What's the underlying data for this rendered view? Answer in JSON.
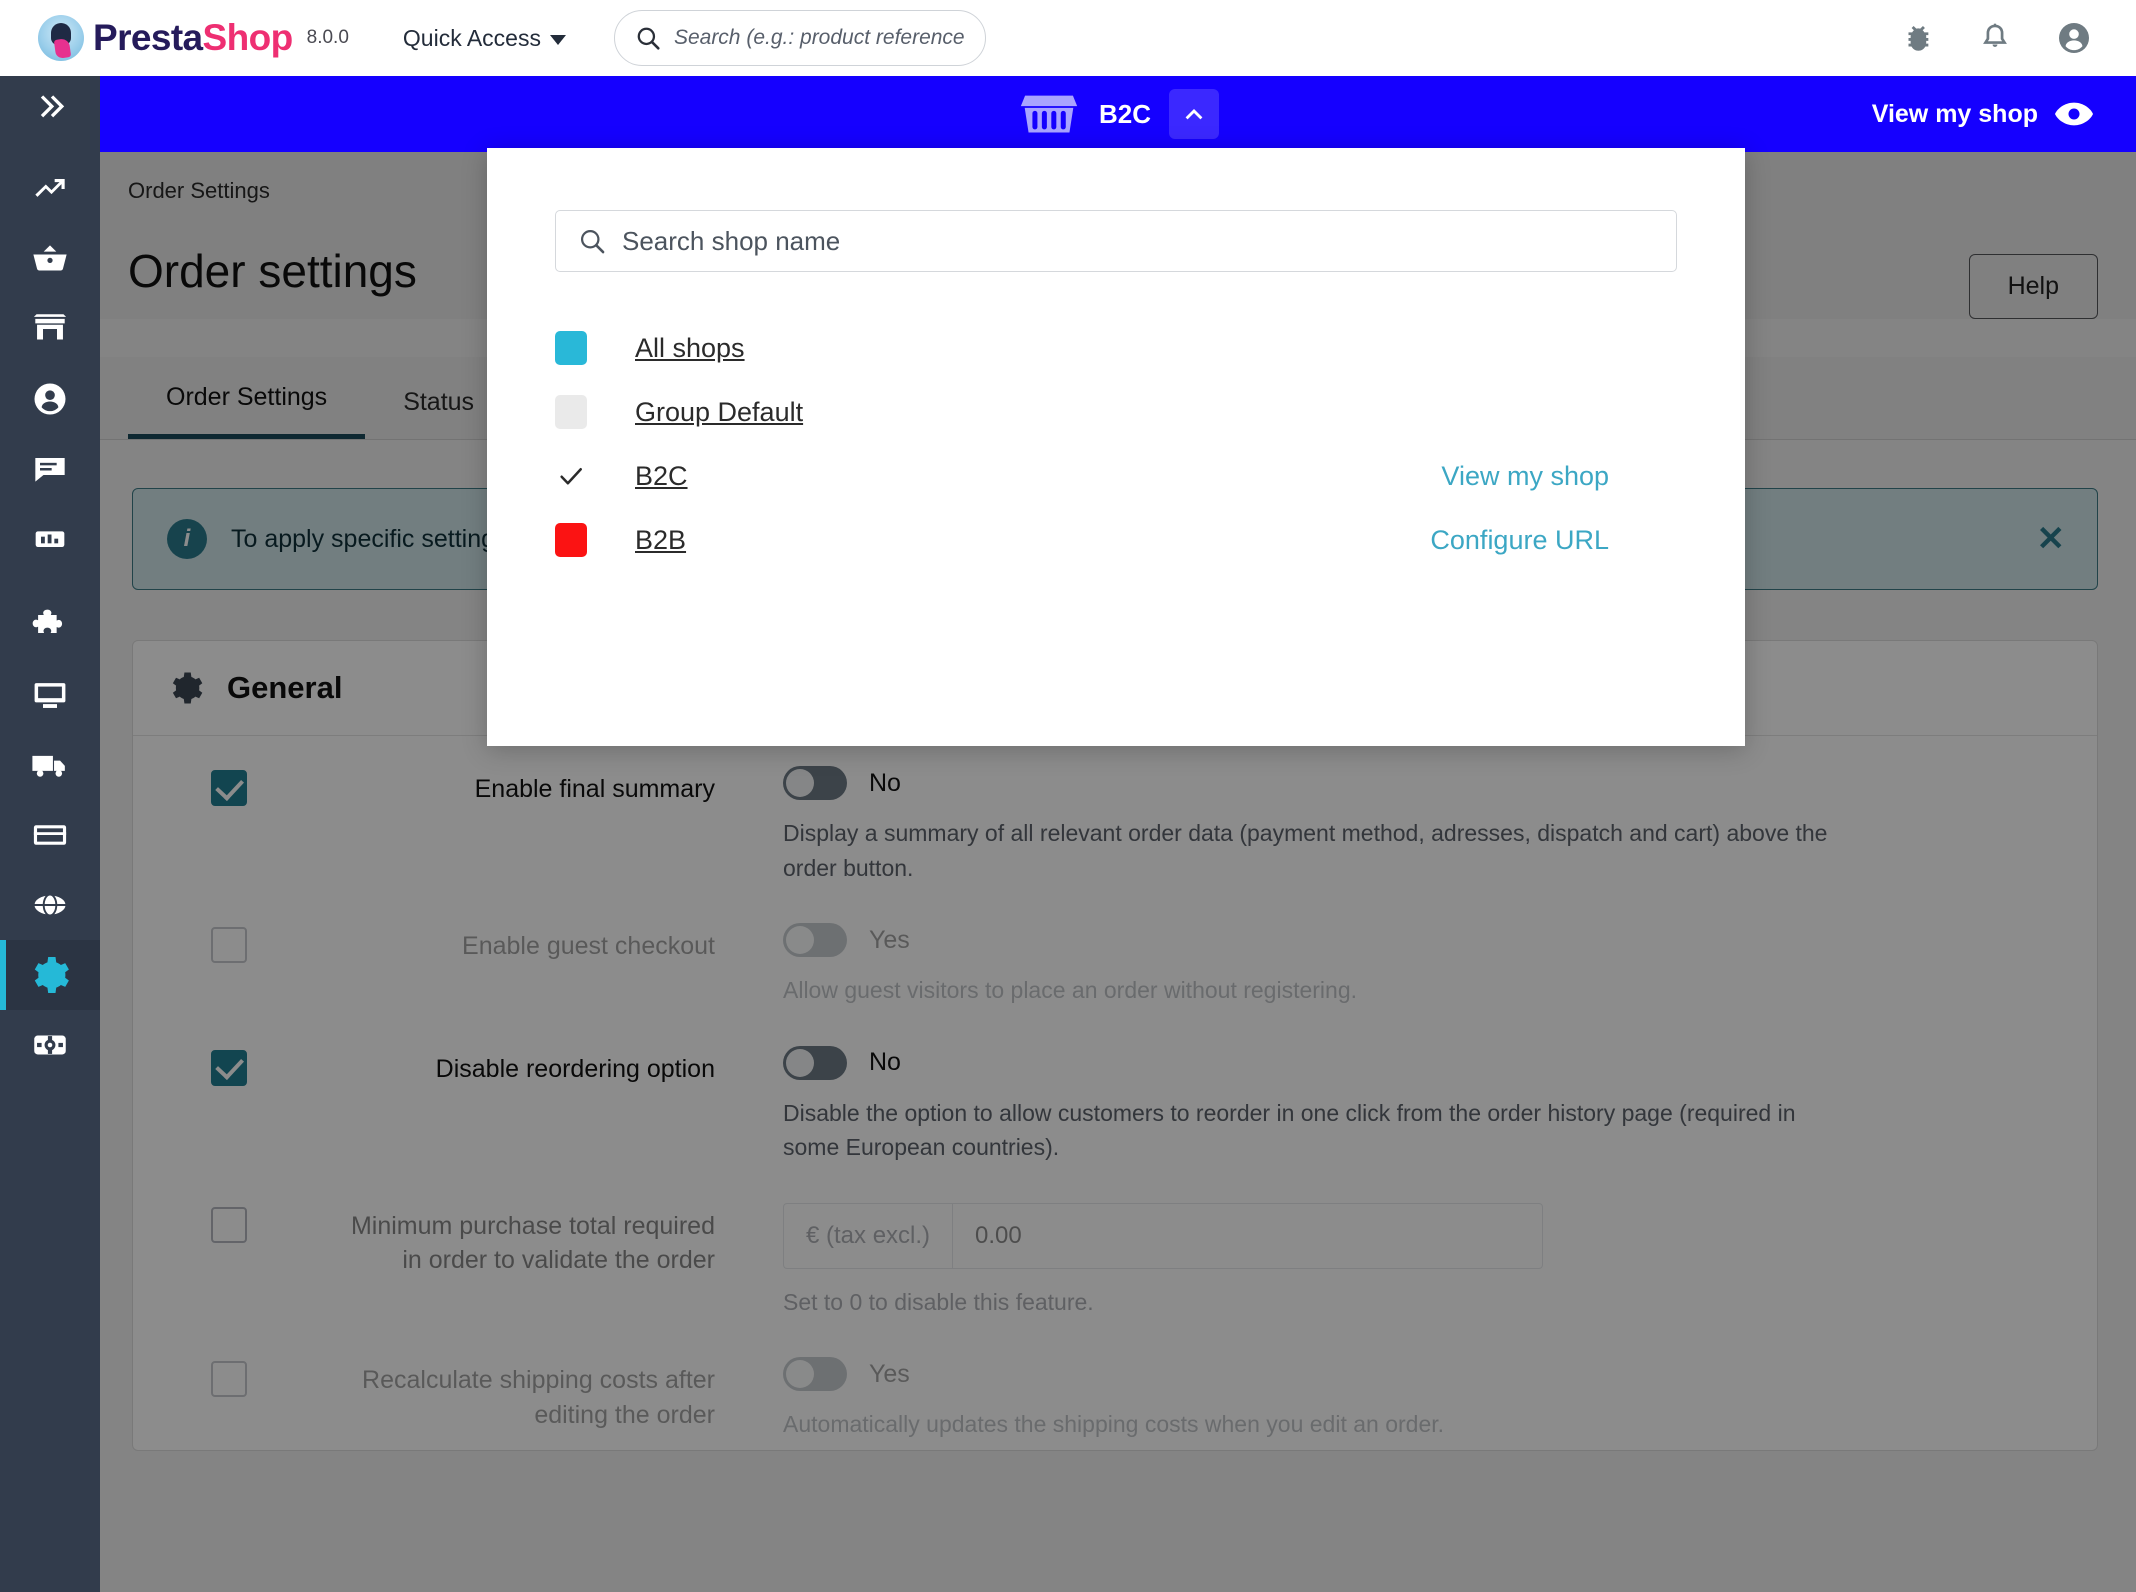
{
  "header": {
    "brand_presta": "Presta",
    "brand_shop": "Shop",
    "version": "8.0.0",
    "quick_access": "Quick Access",
    "search_placeholder": "Search (e.g.: product reference, custon",
    "search_value": "",
    "icons": [
      "bug-icon",
      "bell-icon",
      "account-icon"
    ]
  },
  "shopbar": {
    "shop_name": "B2C",
    "view_my_shop": "View my shop"
  },
  "sidebar": {
    "items": [
      {
        "name": "expand-menu",
        "label": ""
      },
      {
        "name": "dashboard",
        "label": ""
      },
      {
        "name": "orders",
        "label": ""
      },
      {
        "name": "catalog",
        "label": ""
      },
      {
        "name": "customers",
        "label": ""
      },
      {
        "name": "customer-service",
        "label": ""
      },
      {
        "name": "stats",
        "label": ""
      },
      {
        "name": "modules",
        "label": ""
      },
      {
        "name": "design",
        "label": ""
      },
      {
        "name": "shipping",
        "label": ""
      },
      {
        "name": "payment",
        "label": ""
      },
      {
        "name": "international",
        "label": ""
      },
      {
        "name": "shop-parameters",
        "label": ""
      },
      {
        "name": "advanced-parameters",
        "label": ""
      }
    ]
  },
  "page": {
    "breadcrumb": "Order Settings",
    "title": "Order settings",
    "help_button": "Help",
    "tabs": [
      {
        "label": "Order Settings",
        "active": true
      },
      {
        "label": "Status",
        "active": false
      }
    ],
    "alert": {
      "text": "To apply specific settings, please select a specific shop instead of all shops from the shop selector at the top of the page.",
      "close_label": "✕"
    },
    "section": {
      "title": "General",
      "icon": "gear-icon"
    },
    "fields": [
      {
        "id": "enable-final-summary",
        "checkbox_checked": true,
        "label": "Enable final summary",
        "control": "toggle",
        "value": "No",
        "help": "Display a summary of all relevant order data (payment method, adresses, dispatch and cart) above the order button.",
        "muted": false
      },
      {
        "id": "enable-guest-checkout",
        "checkbox_checked": false,
        "label": "Enable guest checkout",
        "control": "toggle",
        "value": "Yes",
        "help": "Allow guest visitors to place an order without registering.",
        "muted": true
      },
      {
        "id": "disable-reordering-option",
        "checkbox_checked": true,
        "label": "Disable reordering option",
        "control": "toggle",
        "value": "No",
        "help": "Disable the option to allow customers to reorder in one click from the order history page (required in some European countries).",
        "muted": false
      },
      {
        "id": "minimum-purchase-total",
        "checkbox_checked": false,
        "label": "Minimum purchase total required in order to validate the order",
        "control": "input",
        "prefix": "€ (tax excl.)",
        "value": "0.00",
        "help": "Set to 0 to disable this feature.",
        "muted": true
      },
      {
        "id": "recalculate-shipping-costs",
        "checkbox_checked": false,
        "label": "Recalculate shipping costs after editing the order",
        "control": "toggle",
        "value": "Yes",
        "help": "Automatically updates the shipping costs when you edit an order.",
        "muted": true
      }
    ]
  },
  "shop_panel": {
    "search_placeholder": "Search shop name",
    "search_value": "",
    "rows": [
      {
        "id": "all-shops",
        "marker": "swatch",
        "color": "#29b8d8",
        "name": "All shops",
        "action": ""
      },
      {
        "id": "group-default",
        "marker": "swatch",
        "color": "#eaeaea",
        "name": "Group Default",
        "action": ""
      },
      {
        "id": "b2c",
        "marker": "check",
        "color": "",
        "name": "B2C",
        "action": "View my shop"
      },
      {
        "id": "b2b",
        "marker": "swatch",
        "color": "#fb1313",
        "name": "B2B",
        "action": "Configure URL"
      }
    ]
  },
  "colors": {
    "shopbar_blue": "#1500ff",
    "sidebar": "#323c4c",
    "accent_cyan": "#25b9d7",
    "link_teal": "#3ca7c4",
    "checkbox_teal": "#217f92"
  }
}
